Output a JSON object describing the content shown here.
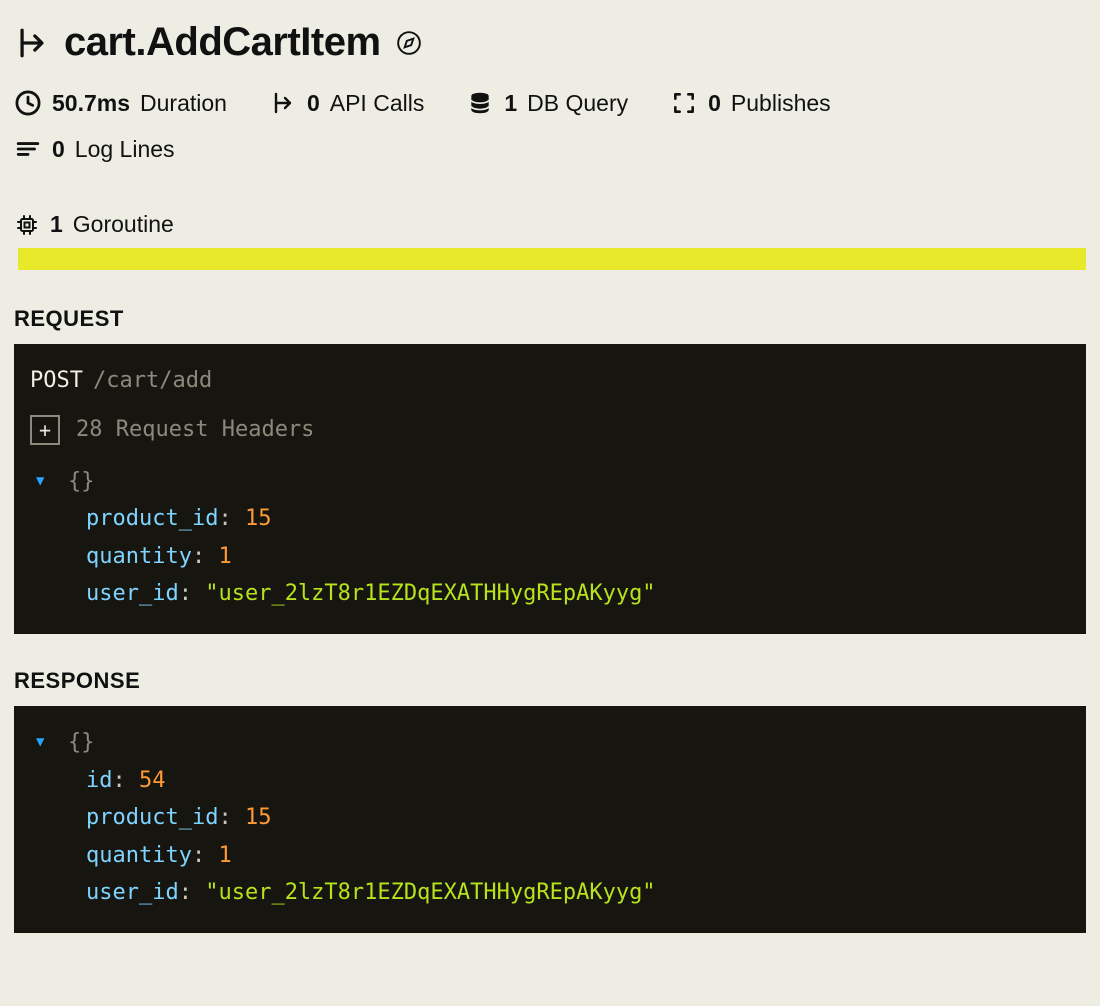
{
  "header": {
    "title": "cart.AddCartItem"
  },
  "stats": {
    "duration_value": "50.7ms",
    "duration_label": "Duration",
    "api_calls_value": "0",
    "api_calls_label": "API Calls",
    "db_query_value": "1",
    "db_query_label": "DB Query",
    "publishes_value": "0",
    "publishes_label": "Publishes",
    "log_lines_value": "0",
    "log_lines_label": "Log Lines"
  },
  "goroutine": {
    "count": "1",
    "label": "Goroutine"
  },
  "request": {
    "section_label": "REQUEST",
    "method": "POST",
    "path": "/cart/add",
    "headers_count": "28",
    "headers_label": "Request Headers",
    "body": {
      "product_id_key": "product_id",
      "product_id_val": "15",
      "quantity_key": "quantity",
      "quantity_val": "1",
      "user_id_key": "user_id",
      "user_id_val": "\"user_2lzT8r1EZDqEXATHHygREpAKyyg\""
    }
  },
  "response": {
    "section_label": "RESPONSE",
    "body": {
      "id_key": "id",
      "id_val": "54",
      "product_id_key": "product_id",
      "product_id_val": "15",
      "quantity_key": "quantity",
      "quantity_val": "1",
      "user_id_key": "user_id",
      "user_id_val": "\"user_2lzT8r1EZDqEXATHHygREpAKyyg\""
    }
  },
  "glyphs": {
    "braces": "{}",
    "colon": ":"
  }
}
